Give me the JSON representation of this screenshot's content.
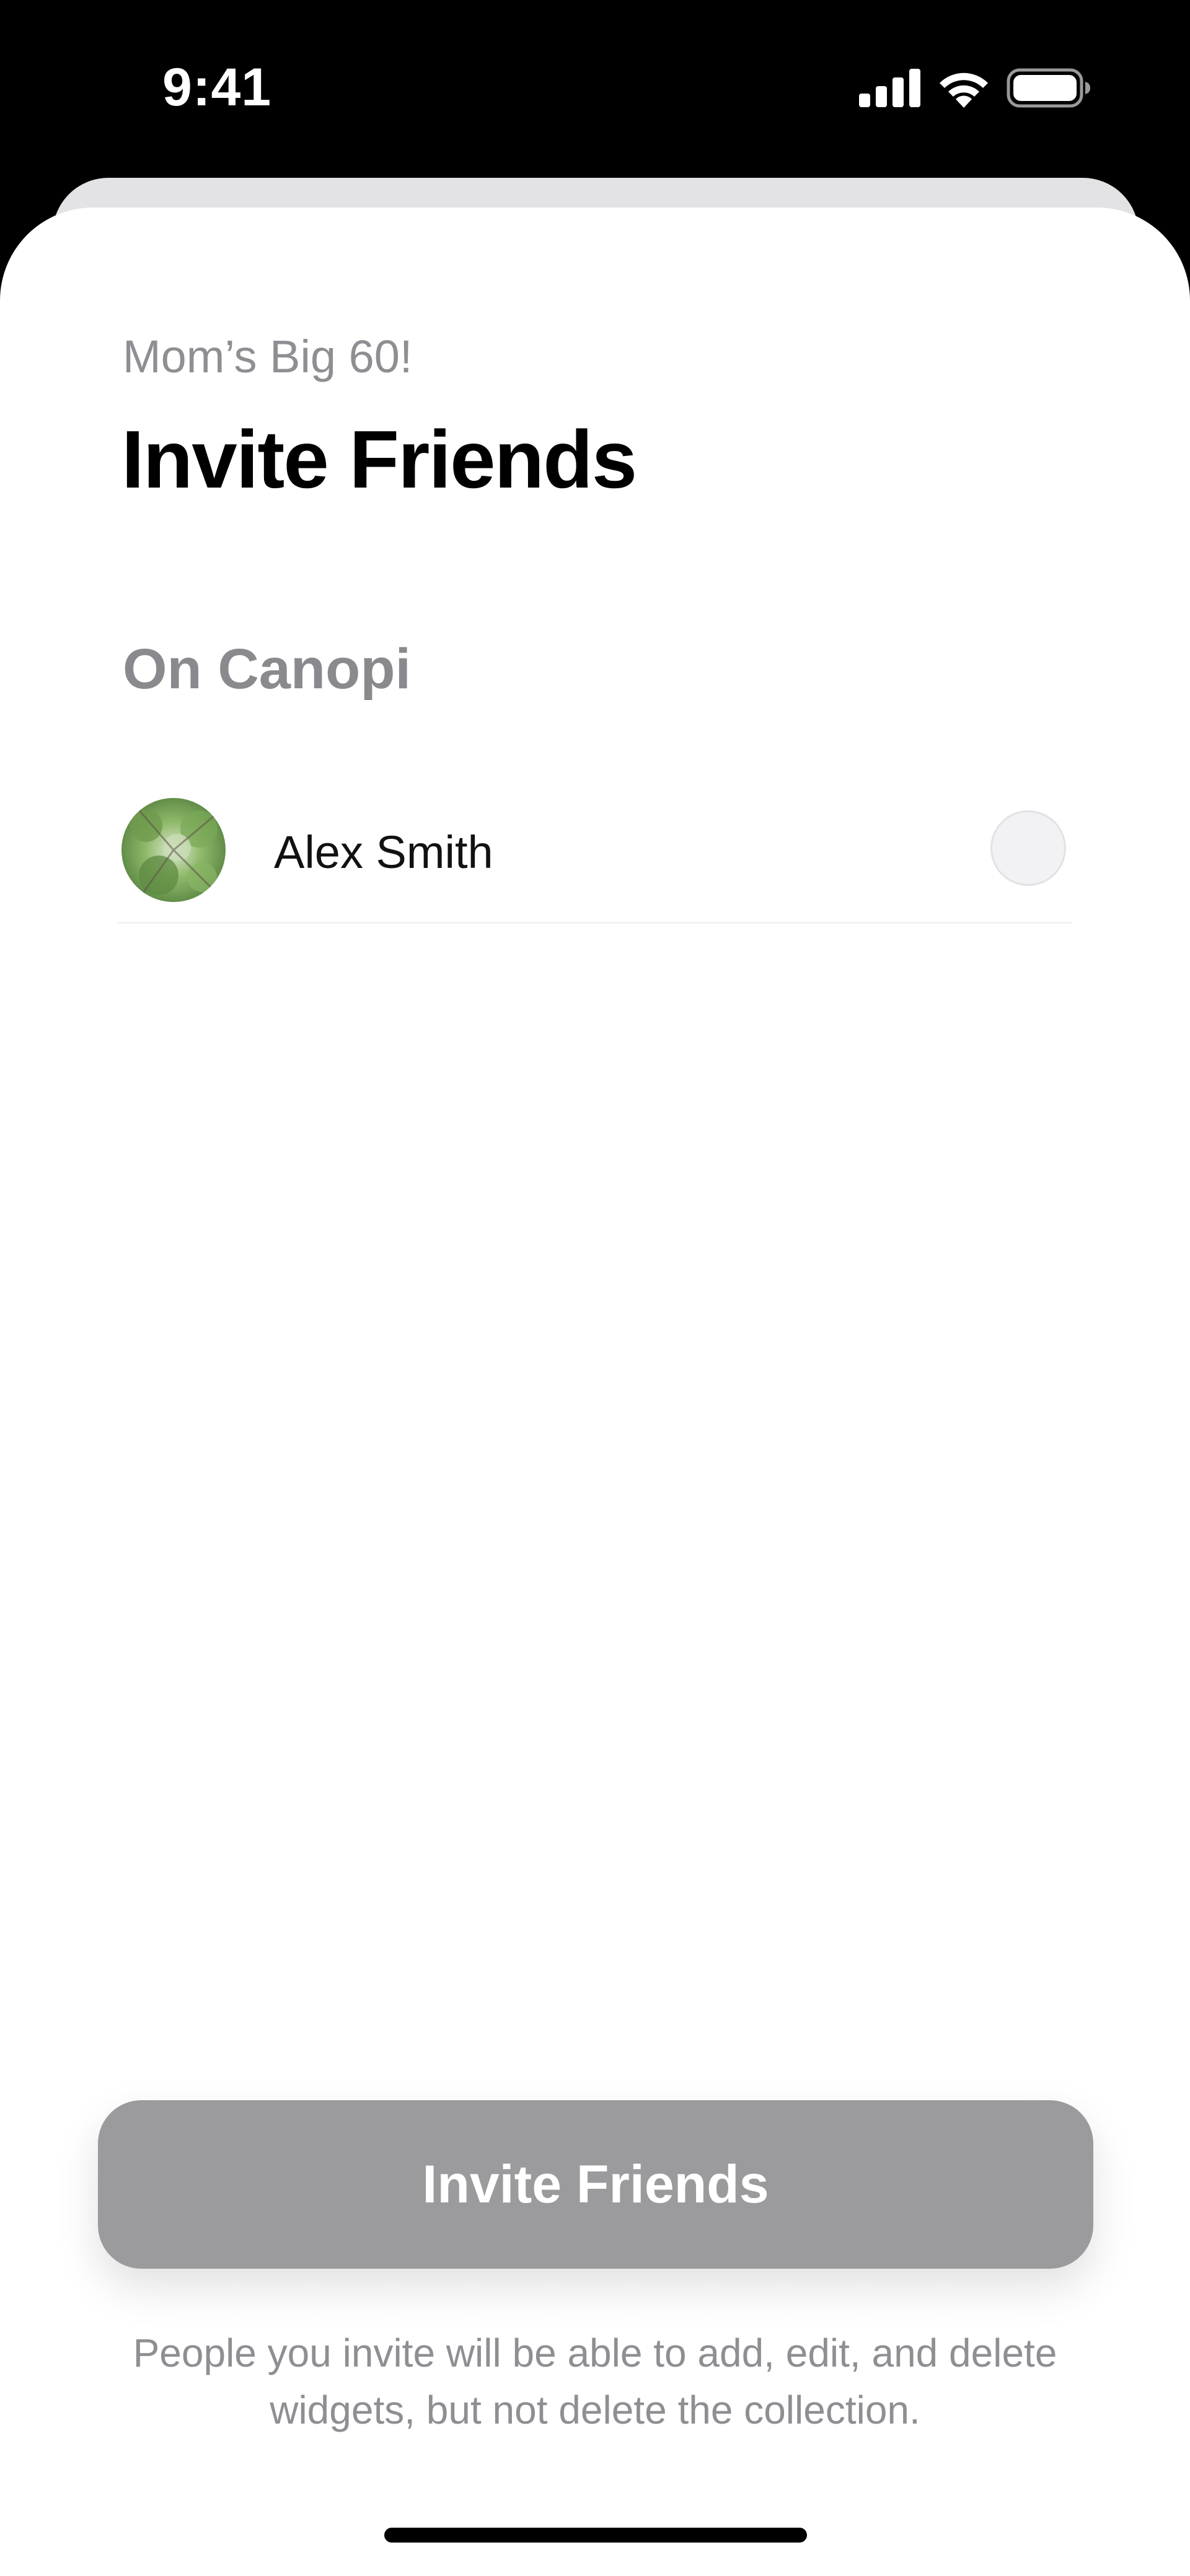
{
  "status_bar": {
    "time": "9:41",
    "icons": [
      "cellular-signal-icon",
      "wifi-icon",
      "battery-icon"
    ]
  },
  "sheet": {
    "subtitle": "Mom’s Big 60!",
    "title": "Invite Friends",
    "section_header": "On Canopi",
    "friends": [
      {
        "name": "Alex Smith",
        "selected": false,
        "avatar": "tree-canopy-photo"
      }
    ]
  },
  "actions": {
    "invite_button_label": "Invite Friends",
    "invite_button_enabled": false,
    "footnote": "People you invite will be able to add, edit, and delete widgets, but not delete the collection."
  },
  "colors": {
    "background": "#000000",
    "sheet": "#ffffff",
    "secondary_text": "#8e8e93",
    "button_disabled": "#9b9a9d"
  }
}
